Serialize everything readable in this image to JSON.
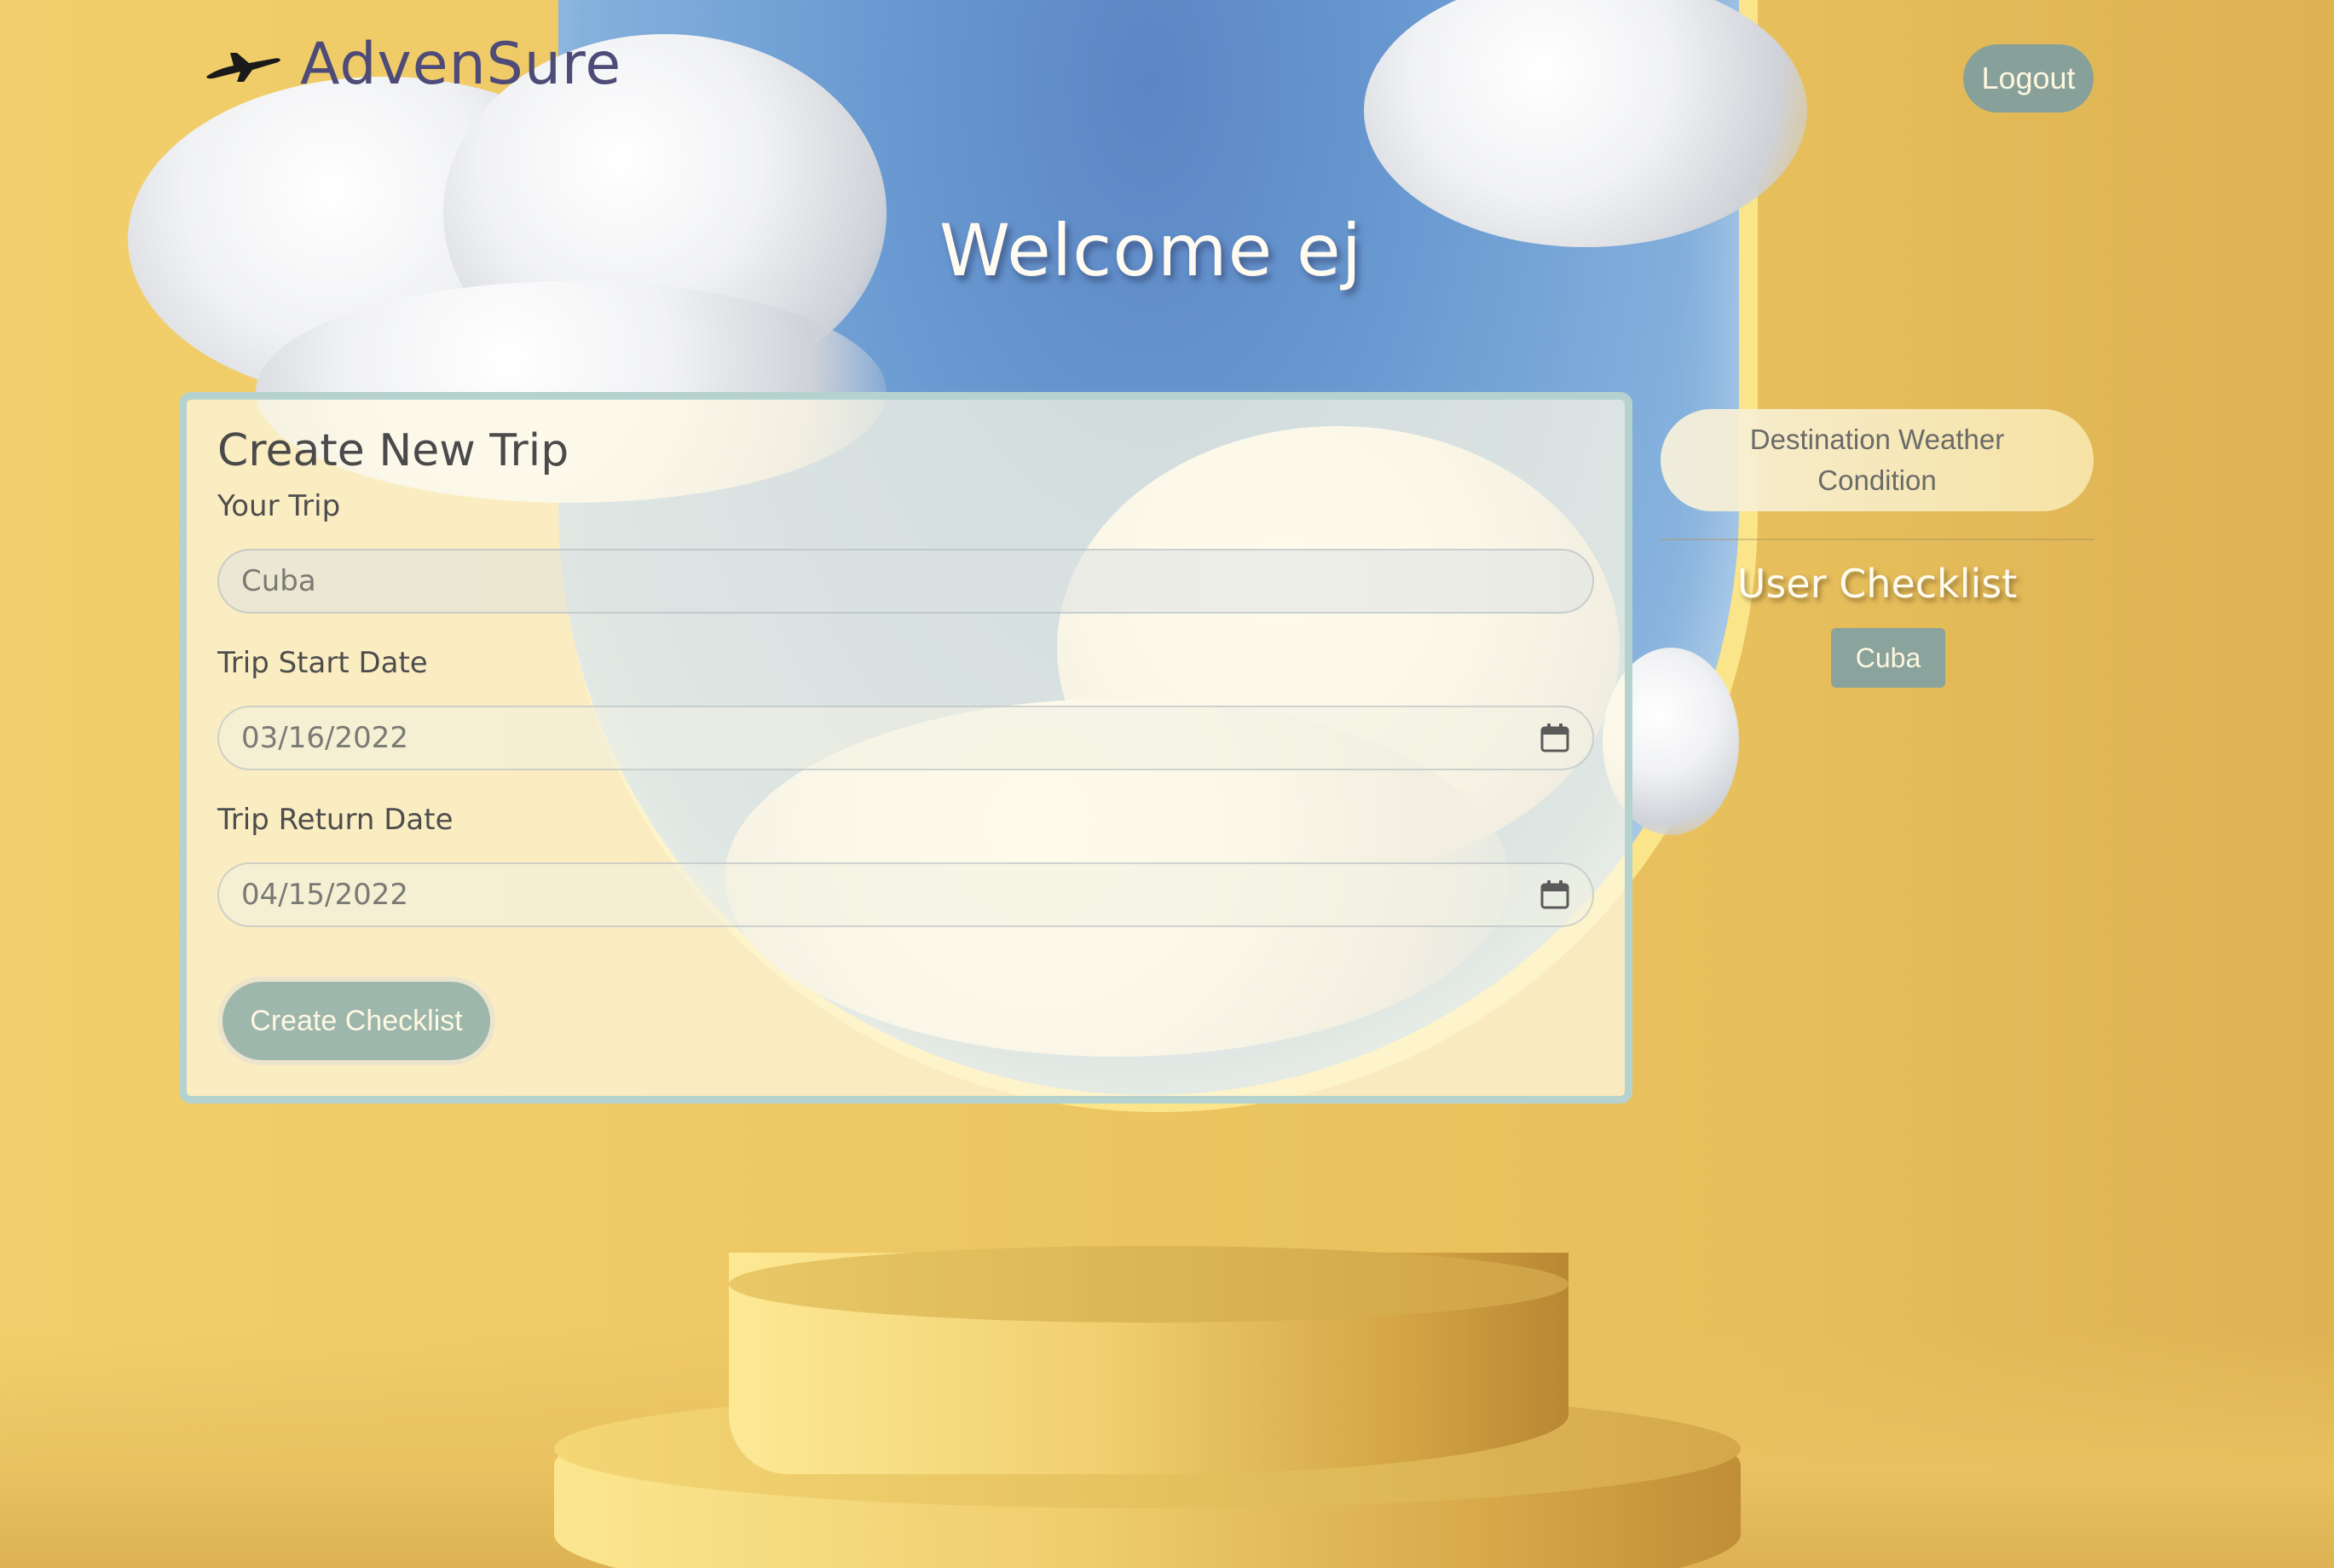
{
  "header": {
    "brand_name": "AdvenSure",
    "logout_label": "Logout"
  },
  "welcome": {
    "text": "Welcome ej"
  },
  "trip_form": {
    "title": "Create New Trip",
    "trip_label": "Your Trip",
    "trip_value": "Cuba",
    "start_label": "Trip Start Date",
    "start_value": "03/16/2022",
    "return_label": "Trip Return Date",
    "return_value": "04/15/2022",
    "submit_label": "Create Checklist"
  },
  "sidebar": {
    "weather_label": "Destination Weather Condition",
    "checklist_title": "User Checklist",
    "checklist_items": [
      "Cuba"
    ]
  },
  "colors": {
    "background": "#edc763",
    "brand": "#4f4b78",
    "button": "#87a19a",
    "card_border": "#b6d2cf",
    "sky": "#6b9bd2"
  },
  "icons": {
    "brand": "plane-icon",
    "date_picker": "calendar-icon"
  }
}
